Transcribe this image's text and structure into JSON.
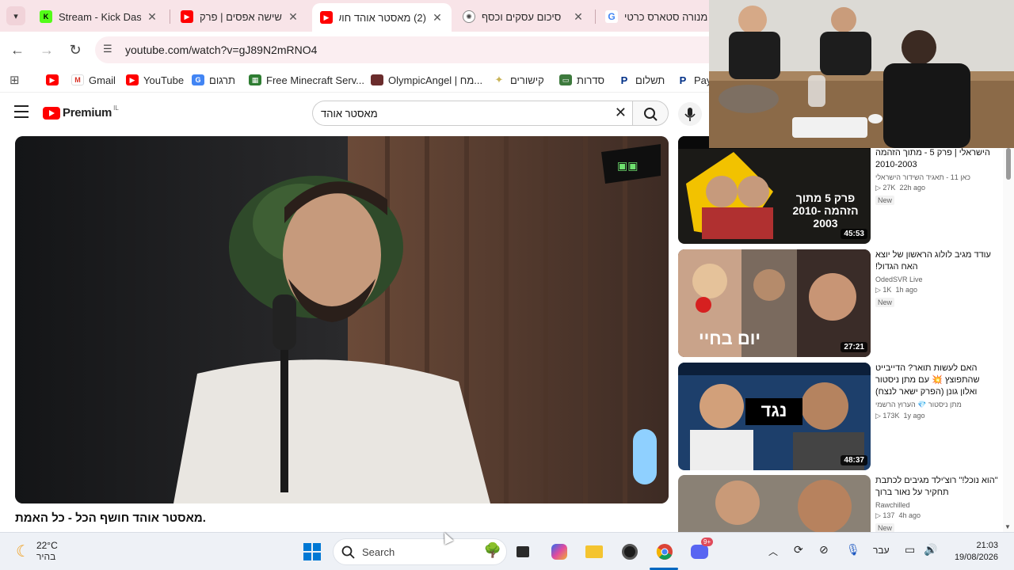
{
  "browser": {
    "tabs": [
      {
        "title": "Stream - Kick Dashb",
        "favicon": "kick-favicon",
        "color": "#53fc18"
      },
      {
        "title": "שישה אפסים | פרק",
        "favicon": "youtube-favicon",
        "color": "#ff0000"
      },
      {
        "title": "(2) מאסטר אוהד חוש",
        "favicon": "youtube-favicon",
        "color": "#ff0000",
        "active": true
      },
      {
        "title": "סיכום עסקים וכסף",
        "favicon": "chatgpt-favicon",
        "color": "#444444"
      },
      {
        "title": "מנורה סטארס כרטי",
        "favicon": "google-favicon",
        "color": "#4285f4"
      }
    ],
    "url": "youtube.com/watch?v=gJ89N2mRNO4",
    "bookmarks": [
      {
        "label": "",
        "icon": "youtube-icon"
      },
      {
        "label": "Gmail",
        "icon": "gmail-icon"
      },
      {
        "label": "YouTube",
        "icon": "youtube-icon"
      },
      {
        "label": "תרגום",
        "icon": "translate-icon"
      },
      {
        "label": "Free Minecraft Serv...",
        "icon": "minecraft-icon"
      },
      {
        "label": "OlympicAngel | מח...",
        "icon": "avatar-icon"
      },
      {
        "label": "קישורים",
        "icon": "folder-icon"
      },
      {
        "label": "סדרות",
        "icon": "tv-icon"
      },
      {
        "label": "תשלום",
        "icon": "paypal-icon"
      },
      {
        "label": "Payl",
        "icon": "paypal-icon"
      }
    ]
  },
  "youtube": {
    "logo_text": "Premium",
    "region": "IL",
    "search_query": "מאסטר אוהד",
    "video_title": "מאסטר אוהד חושף הכל - כל האמת."
  },
  "recommendations": [
    {
      "title": "הישראלי | פרק 5  - מתוך הזהמה 2010-2003",
      "channel": "כאן 11 - תאגיד השידור הישראלי",
      "views": "27K",
      "age": "22h ago",
      "badge": "New",
      "duration": "45:53",
      "thumb_text": "פרק 5 מתוך הזהמה 2010-2003"
    },
    {
      "title": "עודד מגיב לולוג הראשון של יוצא האח הגדול!",
      "channel": "OdedSVR Live",
      "views": "1K",
      "age": "1h ago",
      "badge": "New",
      "duration": "27:21",
      "thumb_text": "יום בחיי"
    },
    {
      "title": "האם לעשות תואר? הדייבייט שהתפוצץ 💥 עם מתן ניסטור ואלון גונן (הפרק ישאר לנצח)",
      "channel": "מתן ניסטור 💎 הערוץ הרשמי",
      "views": "173K",
      "age": "1y ago",
      "badge": "",
      "duration": "48:37",
      "thumb_text": "נגד"
    },
    {
      "title": "\"הוא נוכל!\" רוצ'ילד מגיבים לכתבת תחקיר על נאור ברוך",
      "channel": "Rawchilled",
      "views": "137",
      "age": "4h ago",
      "badge": "New",
      "duration": "",
      "thumb_text": ""
    }
  ],
  "taskbar": {
    "temperature": "22°C",
    "weather_desc": "בהיר",
    "search_label": "Search",
    "language": "עבר",
    "time": "21:03",
    "date": "19/08/2026",
    "discord_badge": "9+"
  }
}
